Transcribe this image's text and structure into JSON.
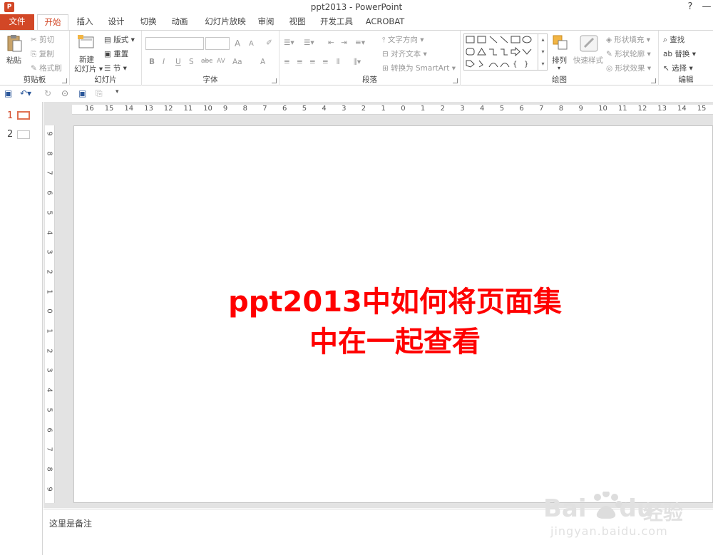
{
  "window": {
    "title": "ppt2013 - PowerPoint",
    "help_icon": "?",
    "minimize_icon": "—"
  },
  "tabs": [
    {
      "label": "文件"
    },
    {
      "label": "开始"
    },
    {
      "label": "插入"
    },
    {
      "label": "设计"
    },
    {
      "label": "切换"
    },
    {
      "label": "动画"
    },
    {
      "label": "幻灯片放映"
    },
    {
      "label": "审阅"
    },
    {
      "label": "视图"
    },
    {
      "label": "开发工具"
    },
    {
      "label": "ACROBAT"
    }
  ],
  "ribbon": {
    "clipboard": {
      "paste": "粘贴",
      "cut": "剪切",
      "copy": "复制",
      "format_painter": "格式刷",
      "label": "剪贴板"
    },
    "slides": {
      "new_slide": "新建",
      "new_slide2": "幻灯片",
      "layout": "版式",
      "reset": "重置",
      "section": "节",
      "label": "幻灯片"
    },
    "font": {
      "bold": "B",
      "italic": "I",
      "underline": "U",
      "shadow": "S",
      "strike": "abc",
      "spacing": "AV",
      "case": "Aa",
      "color": "A",
      "grow": "A",
      "shrink": "A",
      "label": "字体"
    },
    "paragraph": {
      "text_direction": "文字方向",
      "align_text": "对齐文本",
      "smartart": "转换为 SmartArt",
      "label": "段落"
    },
    "drawing": {
      "arrange": "排列",
      "quick_styles": "快速样式",
      "fill": "形状填充",
      "outline": "形状轮廓",
      "effects": "形状效果",
      "label": "绘图"
    },
    "editing": {
      "find": "查找",
      "replace": "替换",
      "select": "选择",
      "label": "编辑"
    }
  },
  "thumbnails": [
    {
      "num": "1"
    },
    {
      "num": "2"
    }
  ],
  "rulers": {
    "horizontal": [
      "16",
      "15",
      "14",
      "13",
      "12",
      "11",
      "10",
      "9",
      "8",
      "7",
      "6",
      "5",
      "4",
      "3",
      "2",
      "1",
      "0",
      "1",
      "2",
      "3",
      "4",
      "5",
      "6",
      "7",
      "8",
      "9",
      "10",
      "11",
      "12",
      "13",
      "14",
      "15"
    ],
    "vertical": [
      "9",
      "8",
      "7",
      "6",
      "5",
      "4",
      "3",
      "2",
      "1",
      "0",
      "1",
      "2",
      "3",
      "4",
      "5",
      "6",
      "7",
      "8",
      "9"
    ]
  },
  "slide": {
    "title_line1": "ppt2013中如何将页面集",
    "title_line2": "中在一起查看",
    "title_color": "#ff0000"
  },
  "notes": {
    "text": "这里是备注"
  },
  "watermark": {
    "brand": "Bai",
    "brand2": "du",
    "cn": "经验",
    "url": "jingyan.baidu.com"
  },
  "colors": {
    "accent": "#d24726"
  }
}
